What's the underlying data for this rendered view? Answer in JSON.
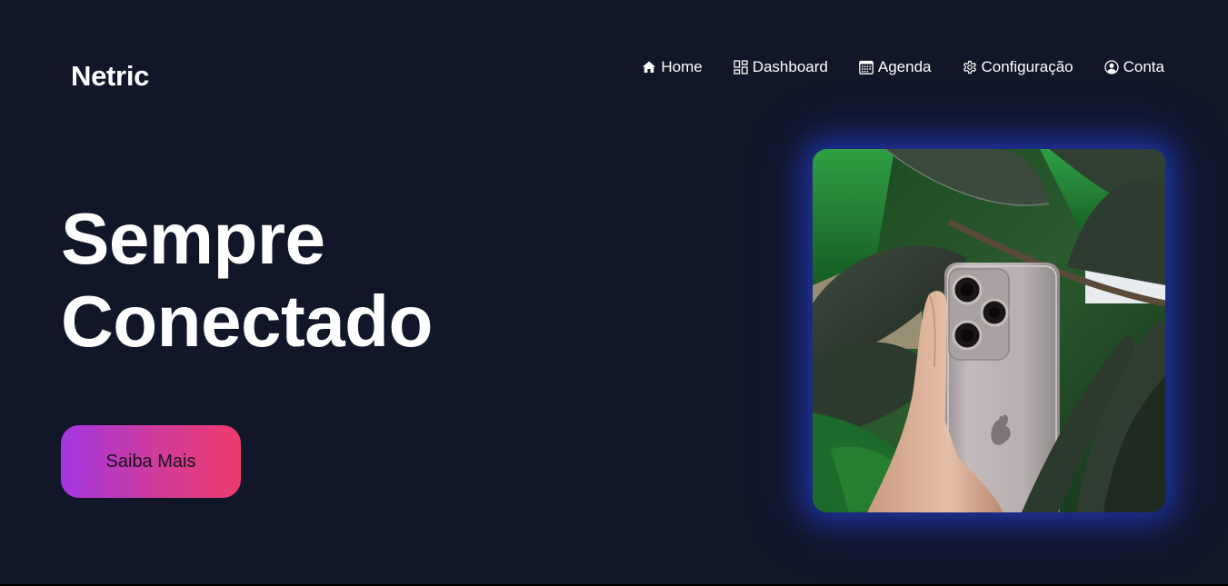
{
  "brand": {
    "name": "Netric"
  },
  "nav": {
    "items": [
      {
        "label": "Home",
        "icon": "home-icon"
      },
      {
        "label": "Dashboard",
        "icon": "dashboard-icon"
      },
      {
        "label": "Agenda",
        "icon": "calendar-icon"
      },
      {
        "label": "Configuração",
        "icon": "gear-icon"
      },
      {
        "label": "Conta",
        "icon": "user-circle-icon"
      }
    ]
  },
  "hero": {
    "title_line1": "Sempre",
    "title_line2": "Conectado",
    "cta_label": "Saiba Mais"
  },
  "colors": {
    "background": "#111729",
    "text": "#ffffff",
    "cta_gradient_start": "#a336e3",
    "cta_gradient_end": "#ef3b6e",
    "image_glow": "#2846e6"
  }
}
